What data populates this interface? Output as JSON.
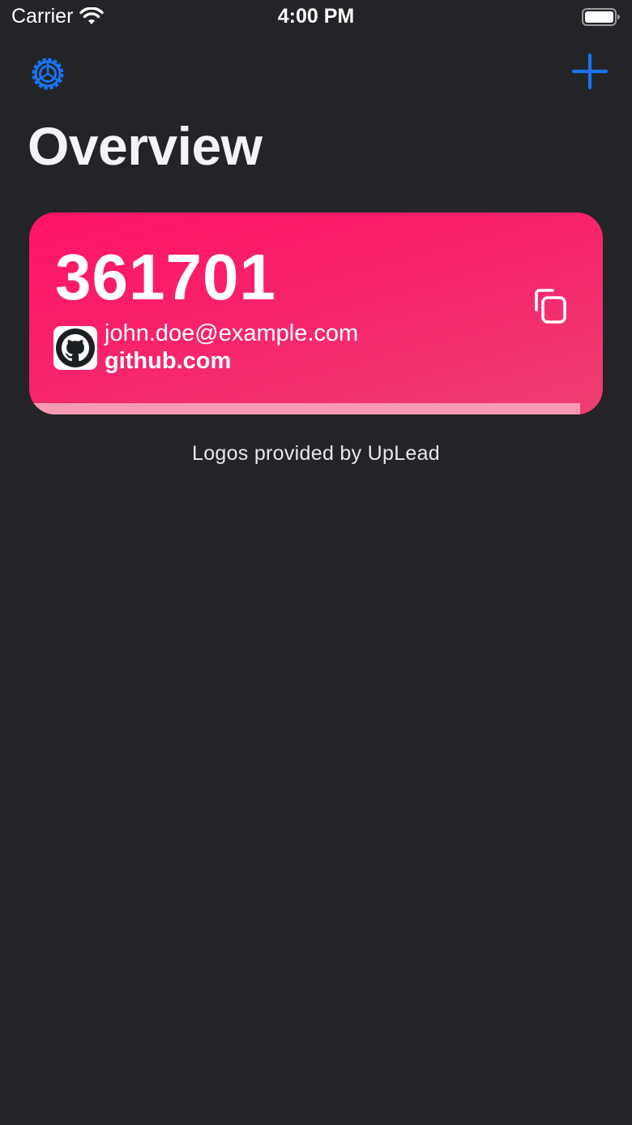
{
  "status_bar": {
    "carrier": "Carrier",
    "time": "4:00 PM",
    "wifi_icon": "wifi-icon",
    "battery_icon": "battery-icon"
  },
  "nav": {
    "settings_icon": "gear-icon",
    "add_icon": "plus-icon",
    "accent_color": "#1a73f0"
  },
  "page": {
    "title": "Overview"
  },
  "tokens": [
    {
      "code": "361701",
      "email": "john.doe@example.com",
      "issuer": "github.com",
      "logo_icon": "github-logo-icon",
      "copy_icon": "copy-icon",
      "card_color": "#ff1468",
      "progress_fraction": 0.96
    }
  ],
  "footer": {
    "credits": "Logos provided by UpLead"
  }
}
